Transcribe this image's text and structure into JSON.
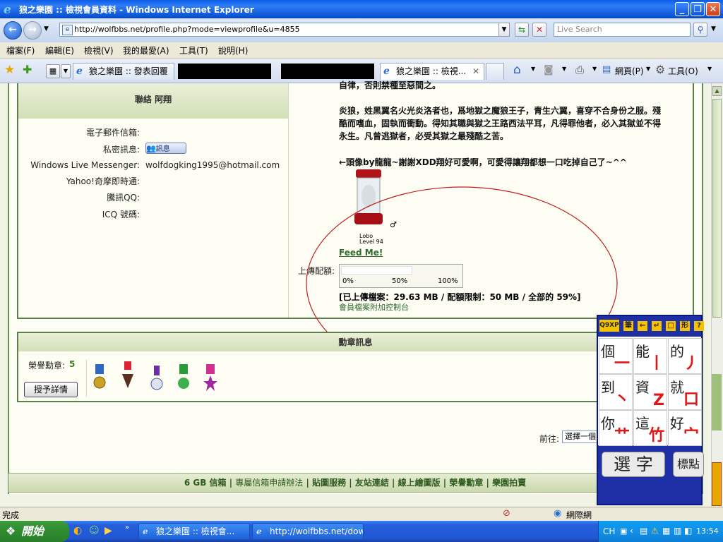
{
  "window": {
    "title": "狼之樂園 :: 檢視會員資料 - Windows Internet Explorer",
    "url": "http://wolfbbs.net/profile.php?mode=viewprofile&u=4855",
    "search_placeholder": "Live Search"
  },
  "menu": [
    "檔案(F)",
    "編輯(E)",
    "檢視(V)",
    "我的最愛(A)",
    "工具(T)",
    "說明(H)"
  ],
  "tabs": {
    "tab1": "狼之樂園 :: 發表回覆",
    "tab2": "狼之樂園 :: 檢視...",
    "toolbar_page": "網頁(P)",
    "toolbar_tools": "工具(O)"
  },
  "contact": {
    "header": "聯絡 阿翔",
    "rows": [
      {
        "label": "電子郵件信箱:",
        "value": ""
      },
      {
        "label": "私密訊息:",
        "value": ""
      },
      {
        "label": "Windows Live Messenger:",
        "value": "wolfdogking1995@hotmail.com"
      },
      {
        "label": "Yahoo!奇摩即時通:",
        "value": ""
      },
      {
        "label": "騰訊QQ:",
        "value": ""
      },
      {
        "label": "ICQ 號碼:",
        "value": ""
      }
    ],
    "pm_button": "訊息"
  },
  "signature": {
    "line0": "自律，否則禁種至惡間之。",
    "line1": "炎狼，姓黑翼名火光炎洛者也，爲地獄之魔狼王子，青生六翼，喜穿不合身份之服。殘",
    "line2": "酷而嗜血，固執而衝動。得知其職與獄之王路西法平耳，凡得罪他者，必入其獄並不得",
    "line3": "永生。凡曾逃獄者，必受其獄之最殘酷之苦。",
    "line4": "←頭像by龍龍~謝謝XDD翔好可愛啊，可愛得讓翔都想一口吃掉自己了~^^",
    "pet_name": "Lobo",
    "pet_level": "Level 94",
    "feed": "Feed Me!"
  },
  "quota": {
    "label": "上傳配額:",
    "fraction": 0.59,
    "ticks": [
      "0%",
      "50%",
      "100%"
    ],
    "summary": "[已上傳檔案：29.63 MB / 配額限制：50 MB / 全部的 59%]",
    "link": "會員檔案附加控制台"
  },
  "medals": {
    "header": "勳章訊息",
    "label": "榮譽勳章:",
    "count": "5",
    "button": "授予詳情"
  },
  "jump": {
    "label": "前往:",
    "select": "選擇一個"
  },
  "footer_links": [
    "6 GB 信箱",
    "專屬信箱申請辦法",
    "貼圖服務",
    "友站連結",
    "線上繪圖版",
    "榮譽勳章",
    "樂園拍賣"
  ],
  "status": {
    "left": "完成",
    "zone": "網際網"
  },
  "taskbar": {
    "start": "開始",
    "item1": "狼之樂園 :: 檢視會...",
    "item2": "http://wolfbbs.net/dow...",
    "lang": "CH",
    "time": "13:54"
  },
  "ime": {
    "toolbar_label": "Q9XP",
    "cells": [
      {
        "ch": "個",
        "st": "一"
      },
      {
        "ch": "能",
        "st": "丨"
      },
      {
        "ch": "的",
        "st": "丿"
      },
      {
        "ch": "到",
        "st": "丶"
      },
      {
        "ch": "資",
        "st": "Z"
      },
      {
        "ch": "就",
        "st": "口"
      },
      {
        "ch": "你",
        "st": "艹"
      },
      {
        "ch": "這",
        "st": "竹"
      },
      {
        "ch": "好",
        "st": "宀"
      }
    ],
    "select_btn": "選 字",
    "punct_btn": "標點"
  }
}
